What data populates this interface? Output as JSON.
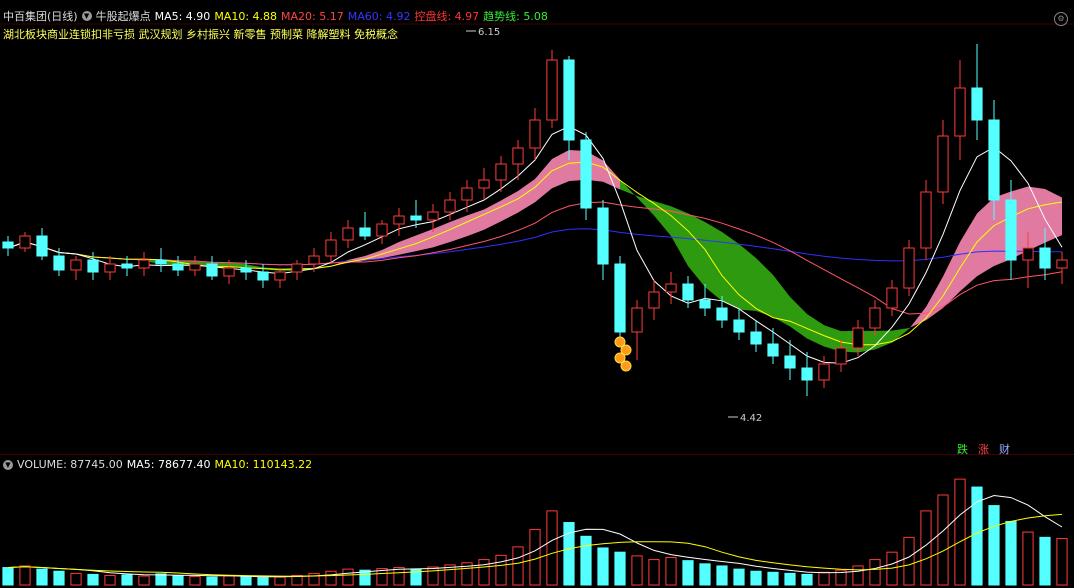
{
  "header": {
    "stock": "中百集团(日线)",
    "indicator": "牛股起爆点",
    "ma5": "MA5: 4.90",
    "ma10": "MA10: 4.88",
    "ma20": "MA20: 5.17",
    "ma60": "MA60: 4.92",
    "kongpan": "控盘线: 4.97",
    "qushi": "趋势线: 5.08"
  },
  "concepts": "湖北板块商业连锁扣非亏损 武汉规划 乡村振兴 新零售 预制菜 降解塑料 免税概念",
  "price_labels": {
    "high": "6.15",
    "low": "4.42"
  },
  "volume_header": {
    "volume": "VOLUME: 87745.00",
    "ma5": "MA5: 78677.40",
    "ma10": "MA10: 110143.22"
  },
  "legend": {
    "die": "跌",
    "zhang": "涨",
    "cai": "财"
  },
  "colors": {
    "up": "#ff3a3a",
    "down": "#54ffff",
    "ma5": "#ffffff",
    "ma10": "#ffff00",
    "ma20": "#ff5566",
    "ma60": "#3030ff",
    "pink": "#e07aa0",
    "green": "#2e9a10"
  },
  "chart_data": {
    "type": "candlestick",
    "candles": [
      [
        5.19,
        5.22,
        5.12,
        5.16
      ],
      [
        5.16,
        5.24,
        5.14,
        5.22
      ],
      [
        5.22,
        5.26,
        5.1,
        5.12
      ],
      [
        5.12,
        5.16,
        5.02,
        5.05
      ],
      [
        5.05,
        5.12,
        5.0,
        5.1
      ],
      [
        5.1,
        5.14,
        5.0,
        5.04
      ],
      [
        5.04,
        5.12,
        5.0,
        5.08
      ],
      [
        5.08,
        5.12,
        5.02,
        5.06
      ],
      [
        5.06,
        5.14,
        5.02,
        5.1
      ],
      [
        5.1,
        5.16,
        5.04,
        5.08
      ],
      [
        5.08,
        5.12,
        5.02,
        5.05
      ],
      [
        5.05,
        5.12,
        5.02,
        5.08
      ],
      [
        5.08,
        5.12,
        5.0,
        5.02
      ],
      [
        5.02,
        5.1,
        4.98,
        5.06
      ],
      [
        5.06,
        5.1,
        5.0,
        5.04
      ],
      [
        5.04,
        5.08,
        4.96,
        5.0
      ],
      [
        5.0,
        5.06,
        4.96,
        5.04
      ],
      [
        5.04,
        5.1,
        5.0,
        5.08
      ],
      [
        5.08,
        5.16,
        5.04,
        5.12
      ],
      [
        5.12,
        5.24,
        5.08,
        5.2
      ],
      [
        5.2,
        5.3,
        5.16,
        5.26
      ],
      [
        5.26,
        5.34,
        5.2,
        5.22
      ],
      [
        5.22,
        5.3,
        5.18,
        5.28
      ],
      [
        5.28,
        5.36,
        5.22,
        5.32
      ],
      [
        5.32,
        5.4,
        5.26,
        5.3
      ],
      [
        5.3,
        5.38,
        5.24,
        5.34
      ],
      [
        5.34,
        5.44,
        5.3,
        5.4
      ],
      [
        5.4,
        5.5,
        5.34,
        5.46
      ],
      [
        5.46,
        5.56,
        5.4,
        5.5
      ],
      [
        5.5,
        5.62,
        5.44,
        5.58
      ],
      [
        5.58,
        5.7,
        5.5,
        5.66
      ],
      [
        5.66,
        5.86,
        5.6,
        5.8
      ],
      [
        5.8,
        6.15,
        5.76,
        6.1
      ],
      [
        6.1,
        6.12,
        5.6,
        5.7
      ],
      [
        5.7,
        5.74,
        5.3,
        5.36
      ],
      [
        5.36,
        5.4,
        5.0,
        5.08
      ],
      [
        5.08,
        5.12,
        4.7,
        4.74
      ],
      [
        4.74,
        4.9,
        4.6,
        4.86
      ],
      [
        4.86,
        5.0,
        4.8,
        4.94
      ],
      [
        4.94,
        5.04,
        4.88,
        4.98
      ],
      [
        4.98,
        5.02,
        4.86,
        4.9
      ],
      [
        4.9,
        4.98,
        4.82,
        4.86
      ],
      [
        4.86,
        4.92,
        4.76,
        4.8
      ],
      [
        4.8,
        4.86,
        4.7,
        4.74
      ],
      [
        4.74,
        4.8,
        4.64,
        4.68
      ],
      [
        4.68,
        4.76,
        4.58,
        4.62
      ],
      [
        4.62,
        4.7,
        4.5,
        4.56
      ],
      [
        4.56,
        4.64,
        4.42,
        4.5
      ],
      [
        4.5,
        4.62,
        4.46,
        4.58
      ],
      [
        4.58,
        4.7,
        4.54,
        4.66
      ],
      [
        4.66,
        4.8,
        4.62,
        4.76
      ],
      [
        4.76,
        4.9,
        4.72,
        4.86
      ],
      [
        4.86,
        5.0,
        4.82,
        4.96
      ],
      [
        4.96,
        5.2,
        4.92,
        5.16
      ],
      [
        5.16,
        5.5,
        5.1,
        5.44
      ],
      [
        5.44,
        5.8,
        5.38,
        5.72
      ],
      [
        5.72,
        6.1,
        5.6,
        5.96
      ],
      [
        5.96,
        6.18,
        5.7,
        5.8
      ],
      [
        5.8,
        5.9,
        5.3,
        5.4
      ],
      [
        5.4,
        5.5,
        5.0,
        5.1
      ],
      [
        5.1,
        5.24,
        4.96,
        5.16
      ],
      [
        5.16,
        5.26,
        5.0,
        5.06
      ],
      [
        5.06,
        5.14,
        4.98,
        5.1
      ]
    ],
    "volumes": [
      33000,
      36000,
      30000,
      26000,
      22000,
      20000,
      18000,
      19000,
      17000,
      21000,
      18000,
      16000,
      15000,
      17000,
      16000,
      14000,
      15000,
      18000,
      22000,
      26000,
      30000,
      28000,
      31000,
      33000,
      30000,
      34000,
      38000,
      42000,
      48000,
      56000,
      72000,
      105000,
      140000,
      118000,
      92000,
      70000,
      62000,
      55000,
      48000,
      52000,
      46000,
      40000,
      36000,
      30000,
      26000,
      24000,
      22000,
      20000,
      24000,
      28000,
      36000,
      48000,
      62000,
      90000,
      140000,
      170000,
      200000,
      185000,
      150000,
      120000,
      100000,
      90000,
      87745
    ],
    "ma_labels": {
      "ma5": "MA5",
      "ma10": "MA10",
      "ma20": "MA20",
      "ma60": "MA60"
    },
    "ylim": [
      4.3,
      6.25
    ]
  }
}
